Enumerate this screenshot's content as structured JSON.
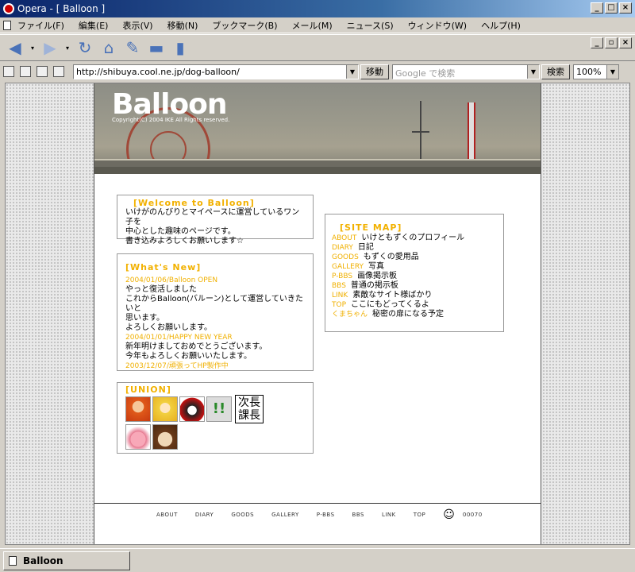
{
  "window": {
    "title": "Opera - [ Balloon ]"
  },
  "menu": [
    "ファイル(F)",
    "編集(E)",
    "表示(V)",
    "移動(N)",
    "ブックマーク(B)",
    "メール(M)",
    "ニュース(S)",
    "ウィンドウ(W)",
    "ヘルプ(H)"
  ],
  "address": {
    "url": "http://shibuya.cool.ne.jp/dog-balloon/",
    "go_label": "移動"
  },
  "search": {
    "placeholder": "Google で検索",
    "button": "検索"
  },
  "zoom": "100%",
  "banner": {
    "logo": "Balloon",
    "copyright": "Copyright(C) 2004 IKE All Rights reserved."
  },
  "welcome": {
    "title": "[Welcome to Balloon]",
    "lines": [
      "いけがのんびりとマイペースに運営しているワン子を",
      "中心とした趣味のページです。",
      "書き込みよろしくお願いします☆"
    ]
  },
  "news": {
    "title": "[What's New]",
    "items": [
      {
        "date": "2004/01/06/Balloon OPEN",
        "lines": [
          "やっと復活しました",
          "これからBalloon(バルーン)として運営していきたいと",
          "思います。",
          "よろしくお願いします。"
        ]
      },
      {
        "date": "2004/01/01/HAPPY NEW YEAR",
        "lines": [
          "新年明けましておめでとうございます。",
          "今年もよろしくお願いいたします。"
        ]
      },
      {
        "date": "2003/12/07/頑張ってHP製作中",
        "lines": []
      }
    ]
  },
  "union": {
    "title": "[UNION]",
    "avatars": [
      "avatar-redhead",
      "avatar-blonde",
      "avatar-mouse",
      "!!",
      "次長課長",
      "avatar-pink-bear",
      "avatar-brown-face"
    ]
  },
  "sitemap": {
    "title": "[SITE MAP]",
    "items": [
      {
        "key": "ABOUT",
        "desc": "いけともずくのプロフィール"
      },
      {
        "key": "DIARY",
        "desc": "日記"
      },
      {
        "key": "GOODS",
        "desc": "もずくの愛用品"
      },
      {
        "key": "GALLERY",
        "desc": "写真"
      },
      {
        "key": "P-BBS",
        "desc": "画像掲示板"
      },
      {
        "key": "BBS",
        "desc": "普通の掲示板"
      },
      {
        "key": "LINK",
        "desc": "素敵なサイト様ばかり"
      },
      {
        "key": "TOP",
        "desc": "ここにもどってくるよ"
      },
      {
        "key": "くまちゃん",
        "desc": "秘密の扉になる予定"
      }
    ]
  },
  "footer": {
    "links": [
      "ABOUT",
      "DIARY",
      "GOODS",
      "GALLERY",
      "P-BBS",
      "BBS",
      "LINK",
      "TOP"
    ],
    "counter": "00070"
  },
  "status": {
    "tab_label": "Balloon"
  },
  "colors": {
    "accent": "#f2b100",
    "titlebar": "#0a246a"
  }
}
